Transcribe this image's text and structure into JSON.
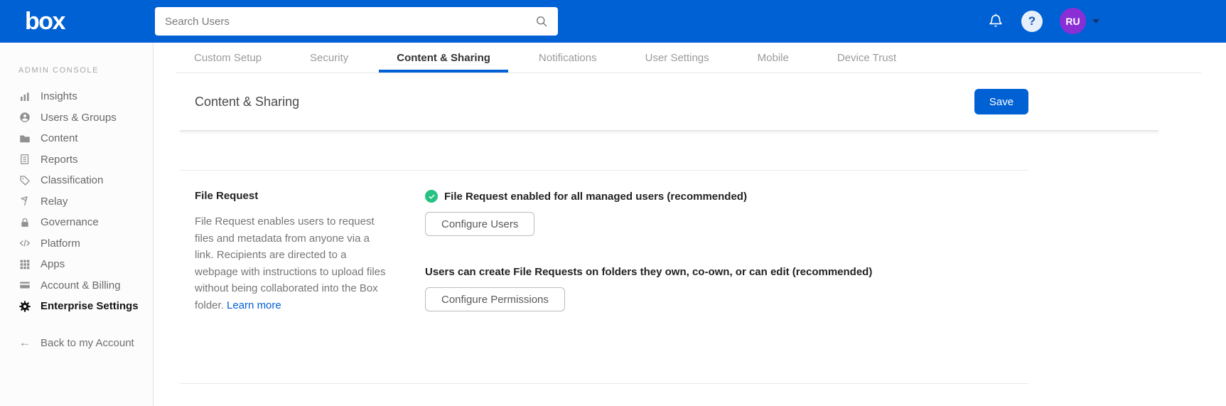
{
  "colors": {
    "brand_blue": "#0061d5",
    "success_green": "#26c281",
    "avatar_purple": "#8a2fd6",
    "link_blue": "#0061d5"
  },
  "topbar": {
    "logo": "box",
    "search_placeholder": "Search Users",
    "help_glyph": "?",
    "avatar_initials": "RU"
  },
  "sidebar": {
    "section_label": "ADMIN CONSOLE",
    "items": [
      {
        "label": "Insights",
        "icon": "bar-chart-icon"
      },
      {
        "label": "Users & Groups",
        "icon": "users-icon"
      },
      {
        "label": "Content",
        "icon": "folder-icon"
      },
      {
        "label": "Reports",
        "icon": "report-icon"
      },
      {
        "label": "Classification",
        "icon": "tag-icon"
      },
      {
        "label": "Relay",
        "icon": "flag-icon"
      },
      {
        "label": "Governance",
        "icon": "lock-icon"
      },
      {
        "label": "Platform",
        "icon": "code-icon"
      },
      {
        "label": "Apps",
        "icon": "grid-icon"
      },
      {
        "label": "Account & Billing",
        "icon": "credit-card-icon"
      },
      {
        "label": "Enterprise Settings",
        "icon": "gear-icon",
        "active": true
      }
    ],
    "back_arrow_glyph": "←",
    "back_label": "Back to my Account"
  },
  "tabs": {
    "active_index": 2,
    "items": [
      {
        "label": "Custom Setup"
      },
      {
        "label": "Security"
      },
      {
        "label": "Content & Sharing"
      },
      {
        "label": "Notifications"
      },
      {
        "label": "User Settings"
      },
      {
        "label": "Mobile"
      },
      {
        "label": "Device Trust"
      }
    ]
  },
  "page": {
    "title": "Content & Sharing",
    "save_label": "Save"
  },
  "file_request": {
    "title": "File Request",
    "description": "File Request enables users to request files and metadata from anyone via a link. Recipients are directed to a webpage with instructions to upload files without being collaborated into the Box folder. ",
    "learn_more_label": "Learn more",
    "status_text": "File Request enabled for all managed users (recommended)",
    "configure_users_label": "Configure Users",
    "permission_text": "Users can create File Requests on folders they own, co-own, or can edit (recommended)",
    "configure_permissions_label": "Configure Permissions"
  }
}
